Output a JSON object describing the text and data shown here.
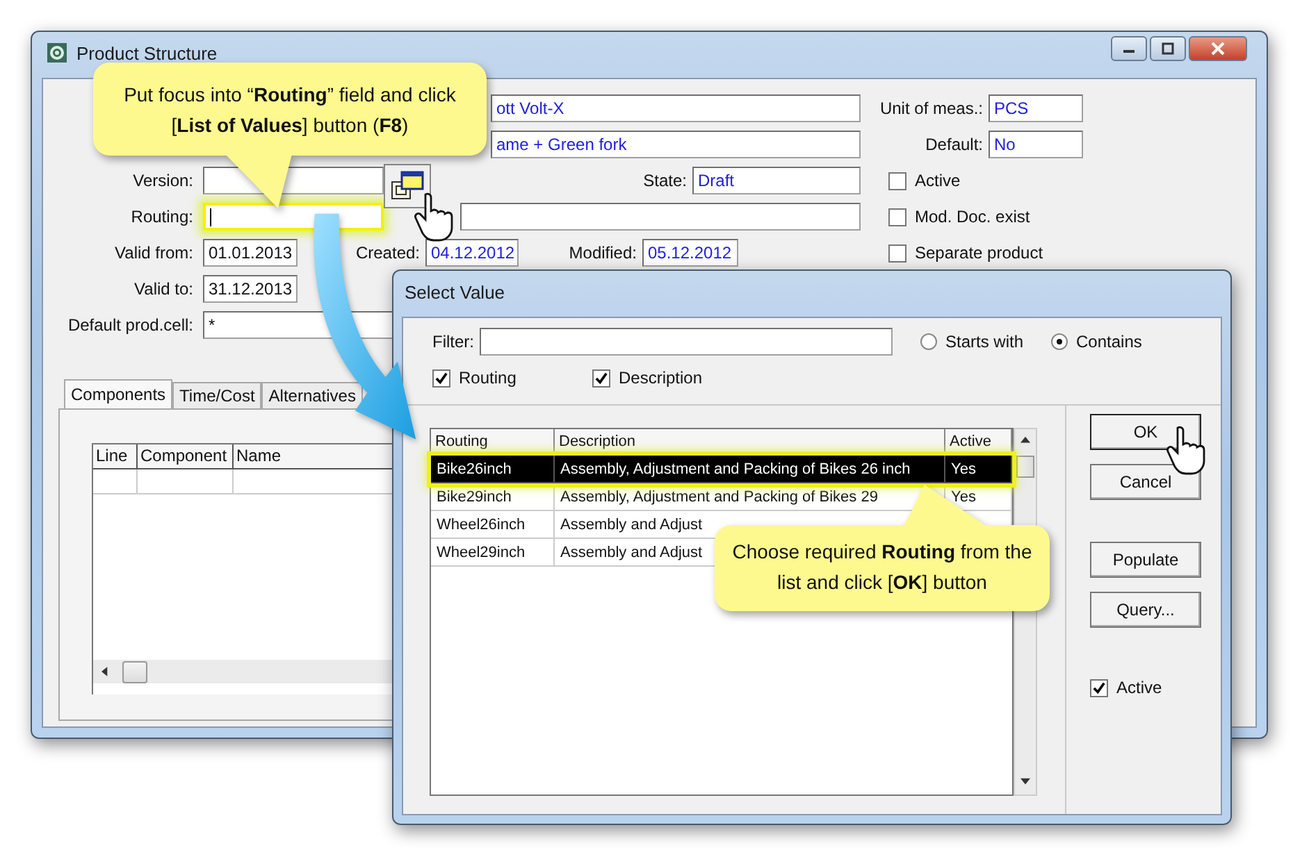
{
  "main_window": {
    "title": "Product Structure",
    "header_fields": [
      {
        "value": "ott Volt-X"
      },
      {
        "value": "ame + Green fork"
      }
    ],
    "side_fields": [
      {
        "label": "Unit of meas.:",
        "value": "PCS"
      },
      {
        "label": "Default:",
        "value": "No"
      }
    ],
    "version": {
      "label": "Version:"
    },
    "state": {
      "label": "State:",
      "value": "Draft"
    },
    "routing": {
      "label": "Routing:",
      "focused": true
    },
    "valid_from": {
      "label": "Valid from:",
      "value": "01.01.2013"
    },
    "created": {
      "label": "Created:",
      "value": "04.12.2012"
    },
    "modified": {
      "label": "Modified:",
      "value": "05.12.2012"
    },
    "valid_to": {
      "label": "Valid to:",
      "value": "31.12.2013"
    },
    "default_prod_cell": {
      "label": "Default prod.cell:",
      "value": "*"
    },
    "checkboxes": [
      {
        "label": "Active",
        "checked": false
      },
      {
        "label": "Mod. Doc. exist",
        "checked": false
      },
      {
        "label": "Separate product",
        "checked": false
      }
    ],
    "tabs": [
      {
        "label": "Components",
        "selected": true
      },
      {
        "label": "Time/Cost",
        "selected": false
      },
      {
        "label": "Alternatives",
        "selected": false
      }
    ],
    "components_table": {
      "columns": [
        "Line",
        "Component",
        "Name"
      ]
    }
  },
  "select_value": {
    "title": "Select Value",
    "filter": {
      "label": "Filter:"
    },
    "match_options": [
      {
        "label": "Starts with",
        "selected": false
      },
      {
        "label": "Contains",
        "selected": true
      }
    ],
    "search_in": [
      {
        "label": "Routing",
        "checked": true
      },
      {
        "label": "Description",
        "checked": true
      }
    ],
    "columns": [
      "Routing",
      "Description",
      "Active"
    ],
    "rows": [
      {
        "routing": "Bike26inch",
        "description": "Assembly, Adjustment and Packing of Bikes 26 inch",
        "active": "Yes",
        "selected": true
      },
      {
        "routing": "Bike29inch",
        "description": "Assembly, Adjustment and Packing of Bikes 29",
        "active": "Yes",
        "selected": false
      },
      {
        "routing": "Wheel26inch",
        "description": "Assembly and Adjust",
        "active": "",
        "selected": false
      },
      {
        "routing": "Wheel29inch",
        "description": "Assembly and Adjust",
        "active": "",
        "selected": false
      }
    ],
    "buttons": [
      {
        "label": "OK"
      },
      {
        "label": "Cancel"
      },
      {
        "label": "Populate"
      },
      {
        "label": "Query..."
      }
    ],
    "active_checkbox": {
      "label": "Active",
      "checked": true
    }
  },
  "callouts": [
    {
      "text": "Put focus into “**Routing**” field and click [**List of Values**] button (**F8**)"
    },
    {
      "text": "Choose required **Routing** from the list and click [**OK**] button"
    }
  ]
}
